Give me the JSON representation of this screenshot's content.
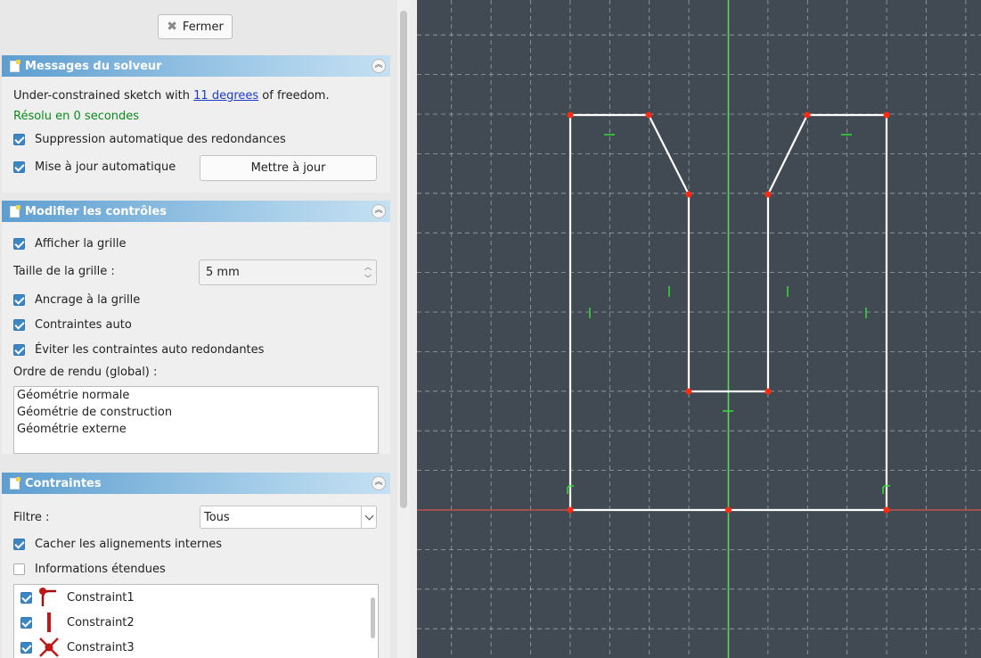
{
  "close_button": {
    "label": "Fermer",
    "icon": "close-icon"
  },
  "solver": {
    "title": "Messages du solveur",
    "msg_prefix": "Under-constrained sketch with ",
    "msg_link": "11 degrees",
    "msg_suffix": " of freedom.",
    "solved": "Résolu en 0 secondes",
    "auto_remove_redundants": {
      "label": "Suppression automatique des redondances",
      "checked": true
    },
    "auto_update": {
      "label": "Mise à jour automatique",
      "checked": true
    },
    "update_button": "Mettre à jour"
  },
  "edit_controls": {
    "title": "Modifier les contrôles",
    "show_grid": {
      "label": "Afficher la grille",
      "checked": true
    },
    "grid_size_label": "Taille de la grille :",
    "grid_size_value": "5 mm",
    "grid_snap": {
      "label": "Ancrage à la grille",
      "checked": true
    },
    "auto_constraints": {
      "label": "Contraintes auto",
      "checked": true
    },
    "avoid_redundant": {
      "label": "Éviter les contraintes auto redondantes",
      "checked": true
    },
    "render_order_label": "Ordre de rendu (global) :",
    "render_order": [
      "Géométrie normale",
      "Géométrie de construction",
      "Géométrie externe"
    ]
  },
  "constraints": {
    "title": "Contraintes",
    "filter_label": "Filtre :",
    "filter_value": "Tous",
    "hide_internal": {
      "label": "Cacher les alignements internes",
      "checked": true
    },
    "extended_info": {
      "label": "Informations étendues",
      "checked": false
    },
    "items": [
      {
        "name": "Constraint1",
        "icon": "coincident-curve-icon",
        "checked": true
      },
      {
        "name": "Constraint2",
        "icon": "vertical-constraint-icon",
        "checked": true
      },
      {
        "name": "Constraint3",
        "icon": "symmetric-constraint-icon",
        "checked": true
      }
    ]
  },
  "colors": {
    "viewport_bg": "#414a52",
    "geometry": "#ffffff",
    "vertex": "#ff2a10",
    "constraint_marker": "#33dd33",
    "y_axis": "#5bd85b",
    "x_axis": "#d9534f",
    "panel_header": "#5d9ed0"
  }
}
